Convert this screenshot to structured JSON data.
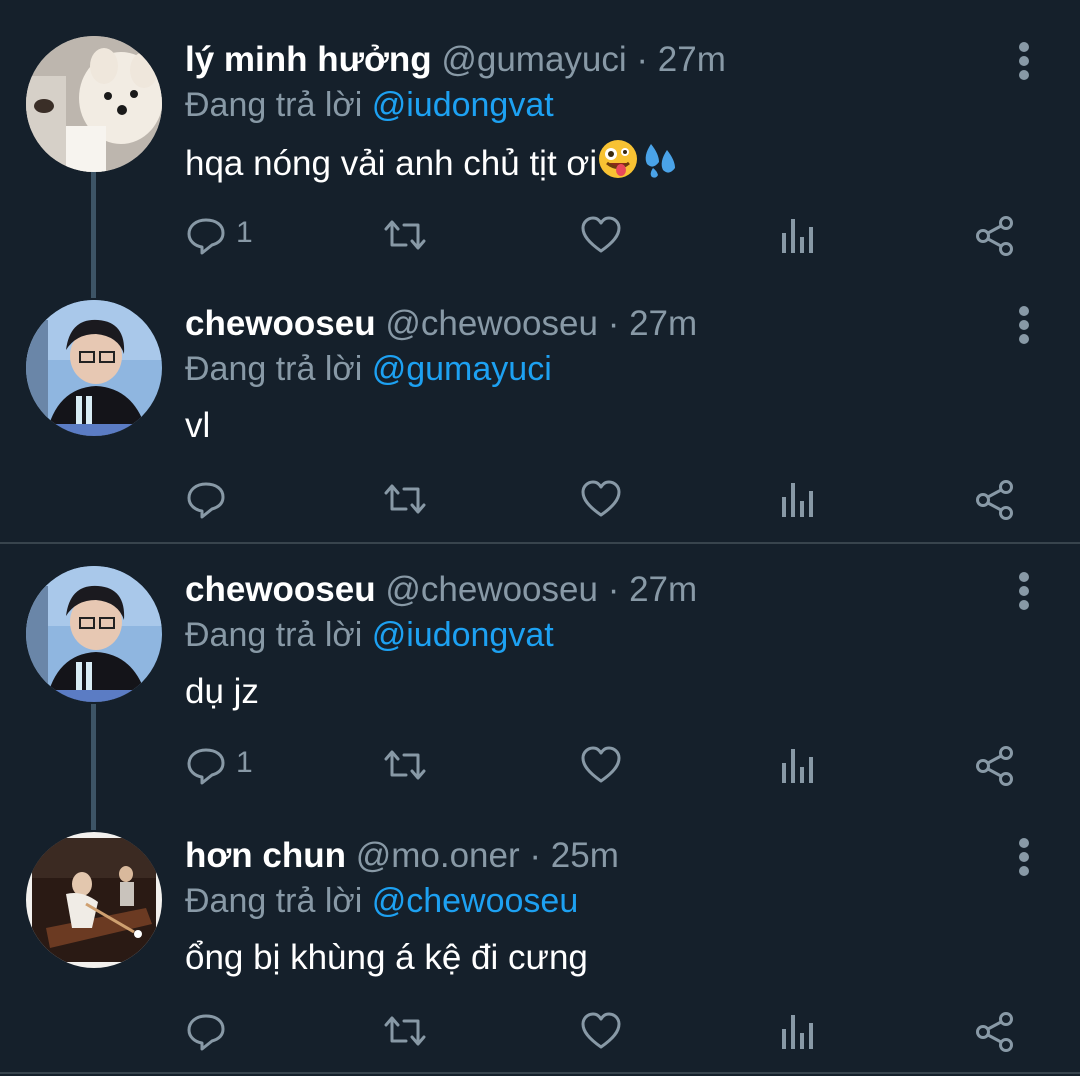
{
  "tweets": [
    {
      "name": "lý minh hưởng",
      "handle": "@gumayuci",
      "separator": "·",
      "time": "27m",
      "reply_prefix": "Đang trả lời",
      "reply_to": "@iudongvat",
      "text": "hqa nóng vải anh chủ tịt ơi",
      "emojis": [
        "zany-face-emoji",
        "sweat-droplets-emoji"
      ],
      "reply_count": "1",
      "avatar": "dog-avatar"
    },
    {
      "name": "chewooseu",
      "handle": "@chewooseu",
      "separator": "·",
      "time": "27m",
      "reply_prefix": "Đang trả lời",
      "reply_to": "@gumayuci",
      "text": "vl",
      "reply_count": "",
      "avatar": "person-avatar"
    },
    {
      "name": "chewooseu",
      "handle": "@chewooseu",
      "separator": "·",
      "time": "27m",
      "reply_prefix": "Đang trả lời",
      "reply_to": "@iudongvat",
      "text": "dụ jz",
      "reply_count": "1",
      "avatar": "person-avatar"
    },
    {
      "name": "hơn chun",
      "handle": "@mo.oner",
      "separator": "·",
      "time": "25m",
      "reply_prefix": "Đang trả lời",
      "reply_to": "@chewooseu",
      "text": "ổng bị khùng á kệ đi cưng",
      "reply_count": "",
      "avatar": "billiards-avatar"
    }
  ],
  "colors": {
    "background": "#15202b",
    "secondary_text": "#8899a6",
    "mention": "#1da1f2",
    "divider": "#38444d"
  },
  "action_icons": [
    "reply-icon",
    "retweet-icon",
    "like-icon",
    "analytics-icon",
    "share-icon"
  ]
}
